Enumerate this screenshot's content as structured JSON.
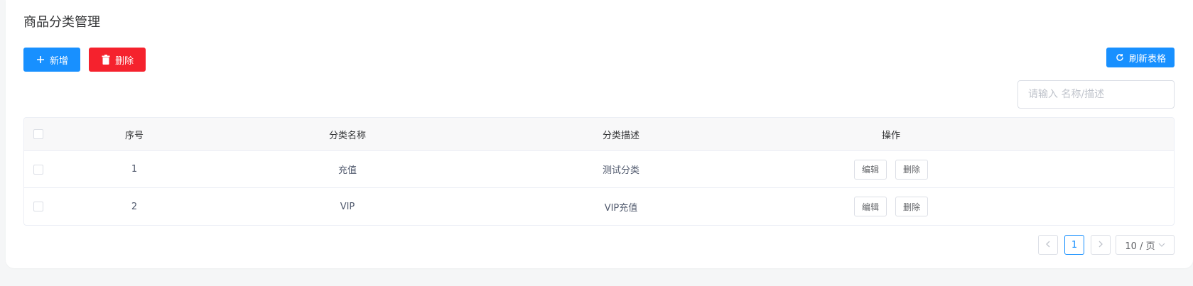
{
  "page": {
    "title": "商品分类管理"
  },
  "toolbar": {
    "add_label": "新增",
    "delete_label": "删除",
    "refresh_label": "刷新表格",
    "add_icon": "plus-icon",
    "delete_icon": "trash-icon",
    "refresh_icon": "refresh-icon"
  },
  "search": {
    "placeholder": "请输入 名称/描述",
    "value": ""
  },
  "table": {
    "columns": [
      "序号",
      "分类名称",
      "分类描述",
      "操作"
    ],
    "rows": [
      {
        "index": "1",
        "name": "充值",
        "description": "测试分类",
        "edit": "编辑",
        "delete": "删除"
      },
      {
        "index": "2",
        "name": "VIP",
        "description": "VIP充值",
        "edit": "编辑",
        "delete": "删除"
      }
    ]
  },
  "pagination": {
    "prev_icon": "chevron-left-icon",
    "current_page": "1",
    "next_icon": "chevron-right-icon",
    "page_size": "10 / 页",
    "page_size_icon": "chevron-down-icon"
  },
  "colors": {
    "primary": "#1890ff",
    "danger": "#f5222d"
  }
}
